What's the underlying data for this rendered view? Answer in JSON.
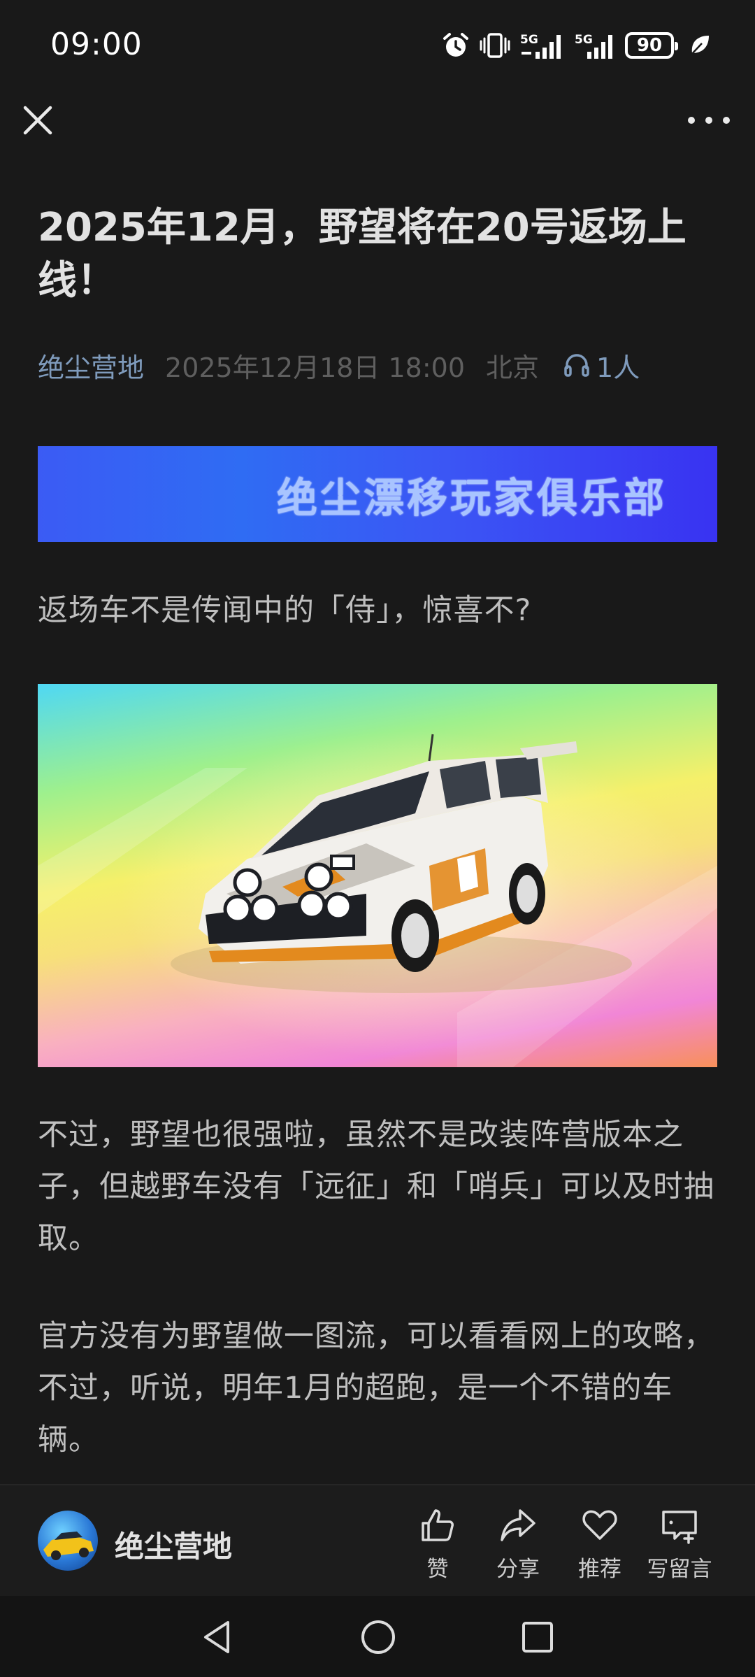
{
  "status_bar": {
    "time": "09:00",
    "battery": "90",
    "signal_1": "5G",
    "signal_2": "5G",
    "icons": [
      "alarm-icon",
      "vibrate-icon",
      "signal-5g-icon",
      "signal-5g-icon",
      "battery-icon",
      "leaf-icon"
    ]
  },
  "top_nav": {
    "close_icon": "close-icon",
    "more_icon": "more-icon"
  },
  "article": {
    "title": "2025年12月，野望将在20号返场上线！",
    "account": "绝尘营地",
    "date": "2025年12月18日 18:00",
    "location": "北京",
    "listeners": "1人",
    "banner_text": "绝尘漂移玩家俱乐部",
    "paragraphs": [
      "返场车不是传闻中的「侍」，惊喜不?",
      "不过，野望也很强啦，虽然不是改装阵营版本之子，但越野车没有「远征」和「哨兵」可以及时抽取。",
      "官方没有为野望做一图流，可以看看网上的攻略，不过，听说，明年1月的超跑，是一个不错的车辆。"
    ]
  },
  "bottom_bar": {
    "author": "绝尘营地",
    "actions": {
      "like": "赞",
      "share": "分享",
      "recommend": "推荐",
      "comment": "写留言"
    }
  },
  "colors": {
    "background": "#191919",
    "account_link": "#7f9bbc",
    "banner_start": "#3b5bf4",
    "banner_end": "#3933f2"
  }
}
